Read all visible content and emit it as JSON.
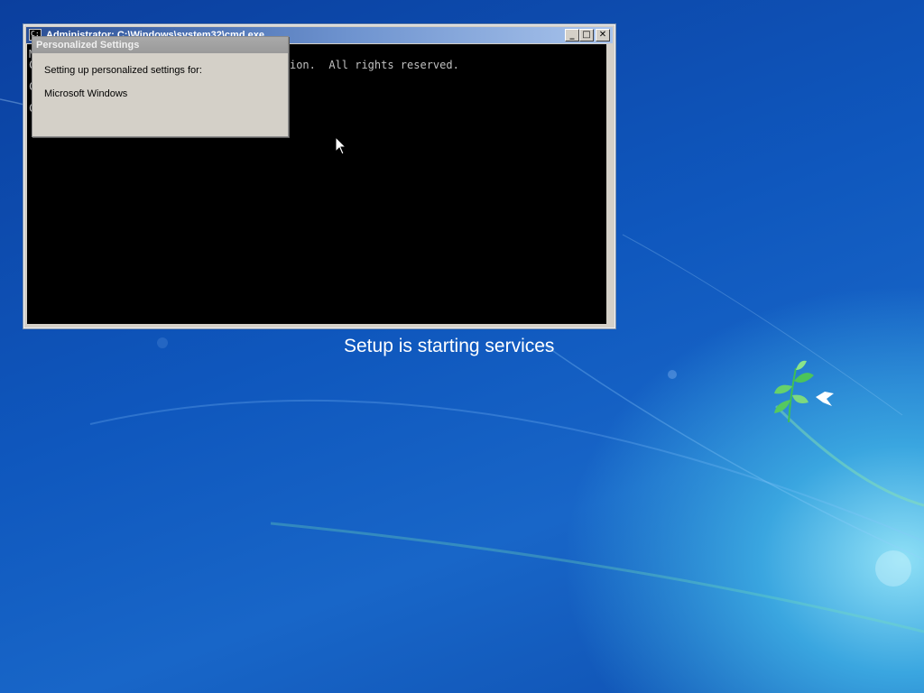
{
  "cmd_window": {
    "title": "Administrator: C:\\Windows\\system32\\cmd.exe",
    "console_lines": [
      "M",
      "C                                      tion.  All rights reserved.",
      "",
      "C",
      "",
      "C"
    ],
    "buttons": {
      "minimize": "_",
      "maximize": "□",
      "close": "✕"
    }
  },
  "settings_dialog": {
    "title": "Personalized Settings",
    "line1": "Setting up personalized settings for:",
    "line2": "Microsoft Windows"
  },
  "status_text": "Setup is starting services",
  "icons": {
    "cursor": "mouse-pointer-icon",
    "system_menu": "cmd-icon",
    "logo": "windows-wallpaper-leaf-icon"
  },
  "colors": {
    "desktop_blue": "#0f57bd",
    "console_bg": "#000000",
    "console_text": "#c0c0c0"
  }
}
